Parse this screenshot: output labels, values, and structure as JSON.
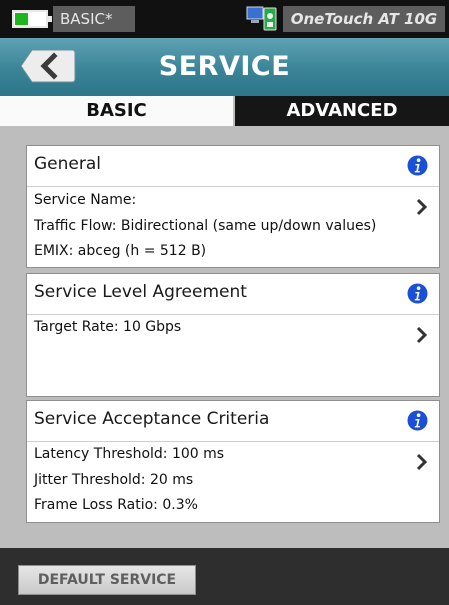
{
  "status_bar": {
    "profile": "BASIC*",
    "device_name": "OneTouch AT 10G",
    "battery_icon": "battery-icon",
    "network_icon": "network-status-icon"
  },
  "header": {
    "title": "SERVICE",
    "back_icon": "back-arrow-icon"
  },
  "tabs": [
    {
      "label": "BASIC",
      "selected": true
    },
    {
      "label": "ADVANCED",
      "selected": false
    }
  ],
  "cards": [
    {
      "title": "General",
      "lines": [
        "Service Name:",
        "Traffic Flow: Bidirectional (same up/down values)",
        "EMIX: abceg (h = 512 B)"
      ]
    },
    {
      "title": "Service Level Agreement",
      "lines": [
        "Target Rate: 10 Gbps"
      ]
    },
    {
      "title": "Service Acceptance Criteria",
      "lines": [
        "Latency Threshold: 100 ms",
        "Jitter Threshold: 20 ms",
        "Frame Loss Ratio: 0.3%"
      ]
    }
  ],
  "footer": {
    "default_button_label": "DEFAULT SERVICE"
  },
  "colors": {
    "title_bar": "#3a8497",
    "info_icon": "#1a4fd6",
    "battery_fill": "#1fb51f"
  }
}
